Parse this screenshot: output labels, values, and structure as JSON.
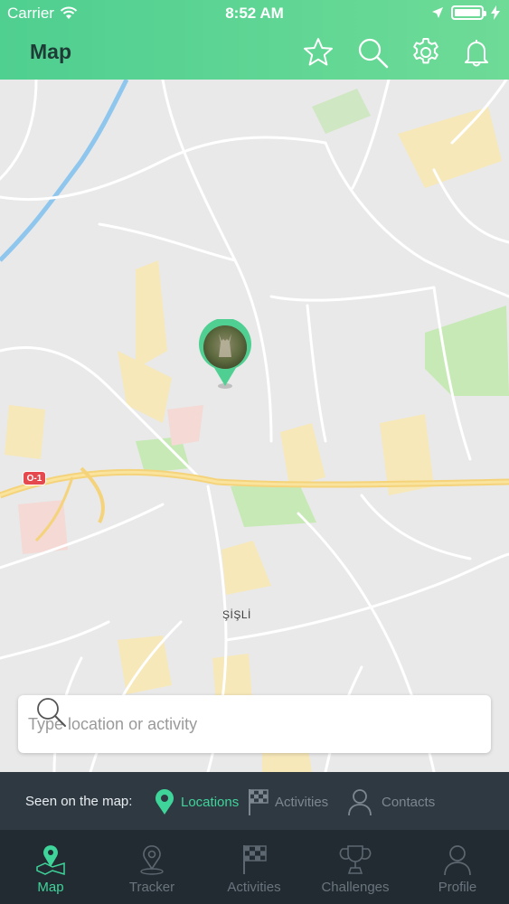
{
  "status_bar": {
    "carrier": "Carrier",
    "time": "8:52 AM"
  },
  "header": {
    "title": "Map",
    "icons": [
      "star-icon",
      "search-icon",
      "gear-icon",
      "bell-icon"
    ]
  },
  "map": {
    "district_label": "ŞİŞLİ",
    "road_tag": "O-1"
  },
  "search": {
    "placeholder": "Type location or activity"
  },
  "seen_on_map": {
    "label": "Seen on the map:",
    "filters": [
      {
        "label": "Locations",
        "icon": "location-pin-icon",
        "active": true
      },
      {
        "label": "Activities",
        "icon": "checkered-flag-icon",
        "active": false
      },
      {
        "label": "Contacts",
        "icon": "person-icon",
        "active": false
      }
    ]
  },
  "tabs": [
    {
      "label": "Map",
      "icon": "map-icon",
      "active": true
    },
    {
      "label": "Tracker",
      "icon": "tracker-icon",
      "active": false
    },
    {
      "label": "Activities",
      "icon": "checkered-flag-icon",
      "active": false
    },
    {
      "label": "Challenges",
      "icon": "trophy-icon",
      "active": false
    },
    {
      "label": "Profile",
      "icon": "person-icon",
      "active": false
    }
  ],
  "colors": {
    "accent": "#3fd49a",
    "header_start": "#4fcf90",
    "header_end": "#6edb97",
    "bar_dark": "#2f3942",
    "tab_bar": "#232b32",
    "inactive": "#7d8790"
  }
}
